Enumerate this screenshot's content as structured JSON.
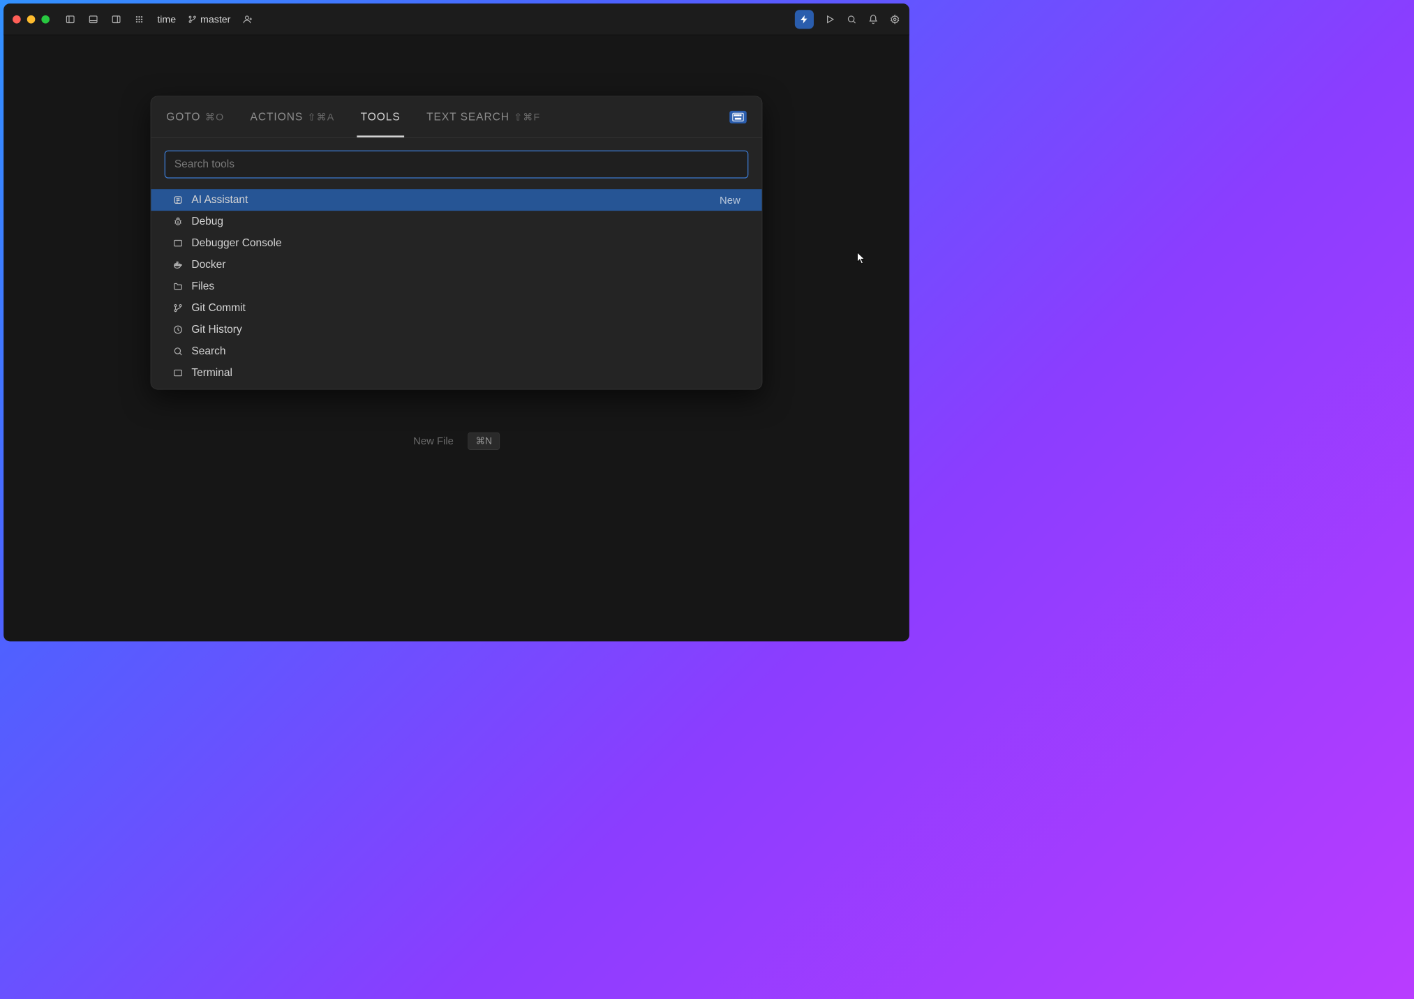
{
  "titlebar": {
    "project_name": "time",
    "branch_name": "master"
  },
  "palette": {
    "tabs": [
      {
        "label": "GOTO",
        "shortcut": "⌘O",
        "active": false
      },
      {
        "label": "ACTIONS",
        "shortcut": "⇧⌘A",
        "active": false
      },
      {
        "label": "TOOLS",
        "shortcut": "",
        "active": true
      },
      {
        "label": "TEXT SEARCH",
        "shortcut": "⇧⌘F",
        "active": false
      }
    ],
    "search_placeholder": "Search tools",
    "search_value": "",
    "results": [
      {
        "icon": "ai-icon",
        "label": "AI Assistant",
        "badge": "New",
        "selected": true
      },
      {
        "icon": "debug-icon",
        "label": "Debug",
        "badge": "",
        "selected": false
      },
      {
        "icon": "console-icon",
        "label": "Debugger Console",
        "badge": "",
        "selected": false
      },
      {
        "icon": "docker-icon",
        "label": "Docker",
        "badge": "",
        "selected": false
      },
      {
        "icon": "folder-icon",
        "label": "Files",
        "badge": "",
        "selected": false
      },
      {
        "icon": "git-commit-icon",
        "label": "Git Commit",
        "badge": "",
        "selected": false
      },
      {
        "icon": "history-icon",
        "label": "Git History",
        "badge": "",
        "selected": false
      },
      {
        "icon": "search-icon",
        "label": "Search",
        "badge": "",
        "selected": false
      },
      {
        "icon": "terminal-icon",
        "label": "Terminal",
        "badge": "",
        "selected": false
      }
    ]
  },
  "hints": {
    "new_file_label": "New File",
    "new_file_shortcut": "⌘N"
  }
}
